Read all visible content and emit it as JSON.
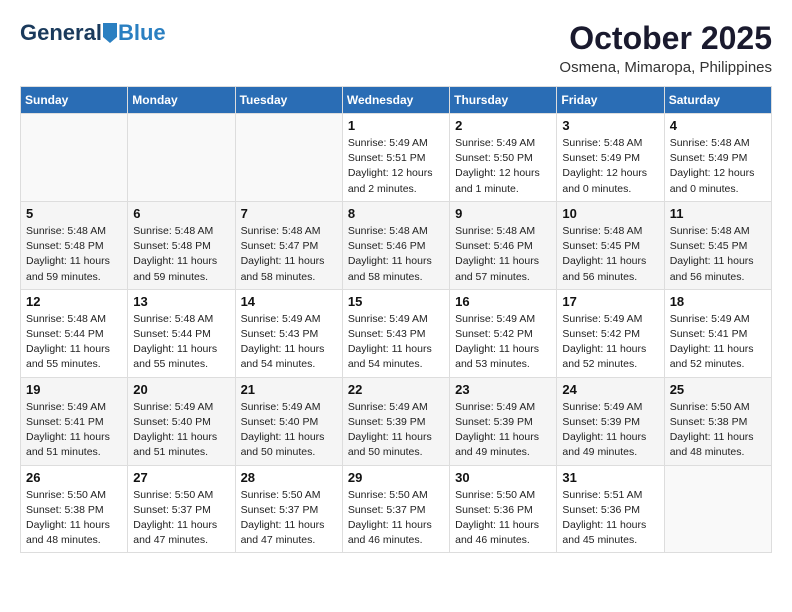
{
  "header": {
    "logo_general": "General",
    "logo_blue": "Blue",
    "month_title": "October 2025",
    "location": "Osmena, Mimaropa, Philippines"
  },
  "weekdays": [
    "Sunday",
    "Monday",
    "Tuesday",
    "Wednesday",
    "Thursday",
    "Friday",
    "Saturday"
  ],
  "weeks": [
    [
      {
        "day": "",
        "info": ""
      },
      {
        "day": "",
        "info": ""
      },
      {
        "day": "",
        "info": ""
      },
      {
        "day": "1",
        "info": "Sunrise: 5:49 AM\nSunset: 5:51 PM\nDaylight: 12 hours\nand 2 minutes."
      },
      {
        "day": "2",
        "info": "Sunrise: 5:49 AM\nSunset: 5:50 PM\nDaylight: 12 hours\nand 1 minute."
      },
      {
        "day": "3",
        "info": "Sunrise: 5:48 AM\nSunset: 5:49 PM\nDaylight: 12 hours\nand 0 minutes."
      },
      {
        "day": "4",
        "info": "Sunrise: 5:48 AM\nSunset: 5:49 PM\nDaylight: 12 hours\nand 0 minutes."
      }
    ],
    [
      {
        "day": "5",
        "info": "Sunrise: 5:48 AM\nSunset: 5:48 PM\nDaylight: 11 hours\nand 59 minutes."
      },
      {
        "day": "6",
        "info": "Sunrise: 5:48 AM\nSunset: 5:48 PM\nDaylight: 11 hours\nand 59 minutes."
      },
      {
        "day": "7",
        "info": "Sunrise: 5:48 AM\nSunset: 5:47 PM\nDaylight: 11 hours\nand 58 minutes."
      },
      {
        "day": "8",
        "info": "Sunrise: 5:48 AM\nSunset: 5:46 PM\nDaylight: 11 hours\nand 58 minutes."
      },
      {
        "day": "9",
        "info": "Sunrise: 5:48 AM\nSunset: 5:46 PM\nDaylight: 11 hours\nand 57 minutes."
      },
      {
        "day": "10",
        "info": "Sunrise: 5:48 AM\nSunset: 5:45 PM\nDaylight: 11 hours\nand 56 minutes."
      },
      {
        "day": "11",
        "info": "Sunrise: 5:48 AM\nSunset: 5:45 PM\nDaylight: 11 hours\nand 56 minutes."
      }
    ],
    [
      {
        "day": "12",
        "info": "Sunrise: 5:48 AM\nSunset: 5:44 PM\nDaylight: 11 hours\nand 55 minutes."
      },
      {
        "day": "13",
        "info": "Sunrise: 5:48 AM\nSunset: 5:44 PM\nDaylight: 11 hours\nand 55 minutes."
      },
      {
        "day": "14",
        "info": "Sunrise: 5:49 AM\nSunset: 5:43 PM\nDaylight: 11 hours\nand 54 minutes."
      },
      {
        "day": "15",
        "info": "Sunrise: 5:49 AM\nSunset: 5:43 PM\nDaylight: 11 hours\nand 54 minutes."
      },
      {
        "day": "16",
        "info": "Sunrise: 5:49 AM\nSunset: 5:42 PM\nDaylight: 11 hours\nand 53 minutes."
      },
      {
        "day": "17",
        "info": "Sunrise: 5:49 AM\nSunset: 5:42 PM\nDaylight: 11 hours\nand 52 minutes."
      },
      {
        "day": "18",
        "info": "Sunrise: 5:49 AM\nSunset: 5:41 PM\nDaylight: 11 hours\nand 52 minutes."
      }
    ],
    [
      {
        "day": "19",
        "info": "Sunrise: 5:49 AM\nSunset: 5:41 PM\nDaylight: 11 hours\nand 51 minutes."
      },
      {
        "day": "20",
        "info": "Sunrise: 5:49 AM\nSunset: 5:40 PM\nDaylight: 11 hours\nand 51 minutes."
      },
      {
        "day": "21",
        "info": "Sunrise: 5:49 AM\nSunset: 5:40 PM\nDaylight: 11 hours\nand 50 minutes."
      },
      {
        "day": "22",
        "info": "Sunrise: 5:49 AM\nSunset: 5:39 PM\nDaylight: 11 hours\nand 50 minutes."
      },
      {
        "day": "23",
        "info": "Sunrise: 5:49 AM\nSunset: 5:39 PM\nDaylight: 11 hours\nand 49 minutes."
      },
      {
        "day": "24",
        "info": "Sunrise: 5:49 AM\nSunset: 5:39 PM\nDaylight: 11 hours\nand 49 minutes."
      },
      {
        "day": "25",
        "info": "Sunrise: 5:50 AM\nSunset: 5:38 PM\nDaylight: 11 hours\nand 48 minutes."
      }
    ],
    [
      {
        "day": "26",
        "info": "Sunrise: 5:50 AM\nSunset: 5:38 PM\nDaylight: 11 hours\nand 48 minutes."
      },
      {
        "day": "27",
        "info": "Sunrise: 5:50 AM\nSunset: 5:37 PM\nDaylight: 11 hours\nand 47 minutes."
      },
      {
        "day": "28",
        "info": "Sunrise: 5:50 AM\nSunset: 5:37 PM\nDaylight: 11 hours\nand 47 minutes."
      },
      {
        "day": "29",
        "info": "Sunrise: 5:50 AM\nSunset: 5:37 PM\nDaylight: 11 hours\nand 46 minutes."
      },
      {
        "day": "30",
        "info": "Sunrise: 5:50 AM\nSunset: 5:36 PM\nDaylight: 11 hours\nand 46 minutes."
      },
      {
        "day": "31",
        "info": "Sunrise: 5:51 AM\nSunset: 5:36 PM\nDaylight: 11 hours\nand 45 minutes."
      },
      {
        "day": "",
        "info": ""
      }
    ]
  ]
}
